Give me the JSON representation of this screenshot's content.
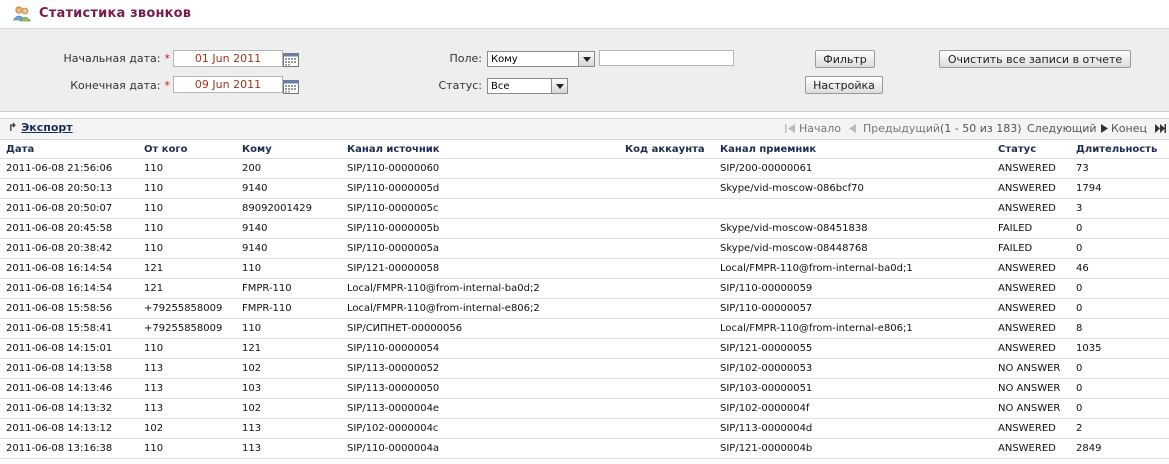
{
  "header": {
    "title": "Статистика звонков",
    "icon": "users-icon"
  },
  "filters": {
    "start_label": "Начальная дата:",
    "end_label": "Конечная дата:",
    "required_mark": "*",
    "start_date": "01 Jun 2011",
    "end_date": "09 Jun 2011",
    "field_label": "Поле:",
    "field_value": "Кому",
    "field_text": "",
    "status_label": "Статус:",
    "status_value": "Все",
    "filter_button": "Фильтр",
    "clear_button": "Очистить все записи в отчете",
    "settings_button": "Настройка"
  },
  "toolbar": {
    "export": "Экспорт",
    "first": "Начало",
    "prev": "Предыдущий",
    "range": "(1 - 50 из 183)",
    "next": "Следующий",
    "last": "Конец"
  },
  "table": {
    "columns": [
      "Дата",
      "От кого",
      "Кому",
      "Канал источник",
      "Код аккаунта",
      "Канал приемник",
      "Статус",
      "Длительность"
    ],
    "rows": [
      [
        "2011-06-08 21:56:06",
        "110",
        "200",
        "SIP/110-00000060",
        "",
        "SIP/200-00000061",
        "ANSWERED",
        "73"
      ],
      [
        "2011-06-08 20:50:13",
        "110",
        "9140",
        "SIP/110-0000005d",
        "",
        "Skype/vid-moscow-086bcf70",
        "ANSWERED",
        "1794"
      ],
      [
        "2011-06-08 20:50:07",
        "110",
        "89092001429",
        "SIP/110-0000005c",
        "",
        "",
        "ANSWERED",
        "3"
      ],
      [
        "2011-06-08 20:45:58",
        "110",
        "9140",
        "SIP/110-0000005b",
        "",
        "Skype/vid-moscow-08451838",
        "FAILED",
        "0"
      ],
      [
        "2011-06-08 20:38:42",
        "110",
        "9140",
        "SIP/110-0000005a",
        "",
        "Skype/vid-moscow-08448768",
        "FAILED",
        "0"
      ],
      [
        "2011-06-08 16:14:54",
        "121",
        "110",
        "SIP/121-00000058",
        "",
        "Local/FMPR-110@from-internal-ba0d;1",
        "ANSWERED",
        "46"
      ],
      [
        "2011-06-08 16:14:54",
        "121",
        "FMPR-110",
        "Local/FMPR-110@from-internal-ba0d;2",
        "",
        "SIP/110-00000059",
        "ANSWERED",
        "0"
      ],
      [
        "2011-06-08 15:58:56",
        "+79255858009",
        "FMPR-110",
        "Local/FMPR-110@from-internal-e806;2",
        "",
        "SIP/110-00000057",
        "ANSWERED",
        "0"
      ],
      [
        "2011-06-08 15:58:41",
        "+79255858009",
        "110",
        "SIP/СИПНЕТ-00000056",
        "",
        "Local/FMPR-110@from-internal-e806;1",
        "ANSWERED",
        "8"
      ],
      [
        "2011-06-08 14:15:01",
        "110",
        "121",
        "SIP/110-00000054",
        "",
        "SIP/121-00000055",
        "ANSWERED",
        "1035"
      ],
      [
        "2011-06-08 14:13:58",
        "113",
        "102",
        "SIP/113-00000052",
        "",
        "SIP/102-00000053",
        "NO ANSWER",
        "0"
      ],
      [
        "2011-06-08 14:13:46",
        "113",
        "103",
        "SIP/113-00000050",
        "",
        "SIP/103-00000051",
        "NO ANSWER",
        "0"
      ],
      [
        "2011-06-08 14:13:32",
        "113",
        "102",
        "SIP/113-0000004e",
        "",
        "SIP/102-0000004f",
        "NO ANSWER",
        "0"
      ],
      [
        "2011-06-08 14:13:12",
        "102",
        "113",
        "SIP/102-0000004c",
        "",
        "SIP/113-0000004d",
        "ANSWERED",
        "2"
      ],
      [
        "2011-06-08 13:16:38",
        "110",
        "113",
        "SIP/110-0000004a",
        "",
        "SIP/121-0000004b",
        "ANSWERED",
        "2849"
      ]
    ]
  }
}
